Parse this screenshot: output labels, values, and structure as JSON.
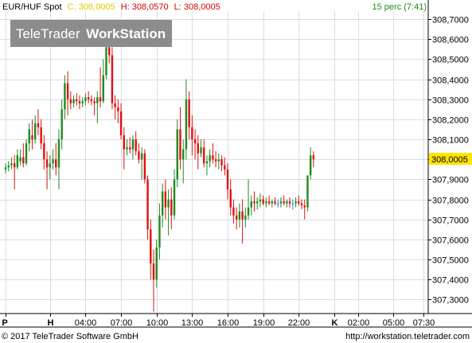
{
  "header": {
    "instrument": "EUR/HUF Spot",
    "close_label": "C: 308,0005",
    "high_label": "H: 308,0570",
    "low_label": "L: 308,0005",
    "interval": "15 perc (7:41)"
  },
  "watermark": {
    "brand": "TeleTrader",
    "product": "WorkStation"
  },
  "footer": {
    "copyright": "© 2017 TeleTrader Software GmbH",
    "url": "http://workstation.teletrader.com"
  },
  "colors": {
    "up": "#1f8a1f",
    "down": "#e01010",
    "doji": "#1a7fd0",
    "grid": "#dcdcdc",
    "last_price_bg": "#ffe400",
    "close_color": "#e8c800",
    "high_low_color": "#d40000",
    "interval_color": "#1a8a1a"
  },
  "chart_data": {
    "type": "candlestick",
    "ylim": [
      307.23,
      308.74
    ],
    "y_ticks": [
      "308,7000",
      "308,6000",
      "308,5000",
      "308,4000",
      "308,3000",
      "308,2000",
      "308,1000",
      "308,0000",
      "307,9000",
      "307,8000",
      "307,7000",
      "307,6000",
      "307,5000",
      "307,4000",
      "307,3000"
    ],
    "y_tick_values": [
      308.7,
      308.6,
      308.5,
      308.4,
      308.3,
      308.2,
      308.1,
      308.0,
      307.9,
      307.8,
      307.7,
      307.6,
      307.5,
      307.4,
      307.3
    ],
    "last_price": 308.0005,
    "last_price_label": "308,0005",
    "x_ticks": [
      {
        "label": "P",
        "bold": true,
        "index": 0
      },
      {
        "label": "H",
        "bold": true,
        "index": 15
      },
      {
        "label": "04:00",
        "index": 27
      },
      {
        "label": "07:00",
        "index": 39
      },
      {
        "label": "10:00",
        "index": 51
      },
      {
        "label": "13:00",
        "index": 63
      },
      {
        "label": "16:00",
        "index": 75
      },
      {
        "label": "19:00",
        "index": 87
      },
      {
        "label": "22:00",
        "index": 99
      },
      {
        "label": "K",
        "bold": true,
        "index": 111
      },
      {
        "label": "02:00",
        "index": 119
      },
      {
        "label": "05:00",
        "index": 131
      },
      {
        "label": "07:30",
        "index": 141
      }
    ],
    "ohlc": [
      [
        307.95,
        307.98,
        307.93,
        307.96
      ],
      [
        307.96,
        307.99,
        307.94,
        307.97
      ],
      [
        307.97,
        308.01,
        307.95,
        307.98
      ],
      [
        307.98,
        308.02,
        307.85,
        307.96
      ],
      [
        307.96,
        308.05,
        307.95,
        308.02
      ],
      [
        307.99,
        308.05,
        307.97,
        308.01
      ],
      [
        308.01,
        308.08,
        307.96,
        307.98
      ],
      [
        307.98,
        308.1,
        307.97,
        308.08
      ],
      [
        308.08,
        308.18,
        308.04,
        308.15
      ],
      [
        308.12,
        308.2,
        308.05,
        308.1
      ],
      [
        308.1,
        308.22,
        308.08,
        308.18
      ],
      [
        308.18,
        308.25,
        308.12,
        308.16
      ],
      [
        308.16,
        308.2,
        308.05,
        308.08
      ],
      [
        308.08,
        308.12,
        307.95,
        308.0
      ],
      [
        308.0,
        308.04,
        307.85,
        307.96
      ],
      [
        307.96,
        308.02,
        307.9,
        307.98
      ],
      [
        307.98,
        308.05,
        307.95,
        308.0
      ],
      [
        308.0,
        308.08,
        307.92,
        307.96
      ],
      [
        307.96,
        308.15,
        307.85,
        308.1
      ],
      [
        308.1,
        308.3,
        308.05,
        308.25
      ],
      [
        308.25,
        308.42,
        308.2,
        308.38
      ],
      [
        308.38,
        308.44,
        308.22,
        308.3
      ],
      [
        308.3,
        308.34,
        308.25,
        308.28
      ],
      [
        308.28,
        308.32,
        308.26,
        308.3
      ],
      [
        308.3,
        308.33,
        308.27,
        308.29
      ],
      [
        308.29,
        308.32,
        308.25,
        308.28
      ],
      [
        308.28,
        308.31,
        308.26,
        308.29
      ],
      [
        308.29,
        308.33,
        308.27,
        308.31
      ],
      [
        308.31,
        308.34,
        308.28,
        308.3
      ],
      [
        308.3,
        308.32,
        308.27,
        308.29
      ],
      [
        308.29,
        308.31,
        308.22,
        308.28
      ],
      [
        308.28,
        308.34,
        308.18,
        308.31
      ],
      [
        308.31,
        308.46,
        308.26,
        308.29
      ],
      [
        308.29,
        308.5,
        308.28,
        308.42
      ],
      [
        308.42,
        308.6,
        308.4,
        308.56
      ],
      [
        308.56,
        308.59,
        308.48,
        308.52
      ],
      [
        308.52,
        308.56,
        308.25,
        308.28
      ],
      [
        308.28,
        308.32,
        308.2,
        308.26
      ],
      [
        308.26,
        308.3,
        308.18,
        308.24
      ],
      [
        308.24,
        308.28,
        308.1,
        308.12
      ],
      [
        308.12,
        308.16,
        307.95,
        308.05
      ],
      [
        308.05,
        308.1,
        308.02,
        308.06
      ],
      [
        308.06,
        308.11,
        308.03,
        308.05
      ],
      [
        308.05,
        308.12,
        308.0,
        308.1
      ],
      [
        308.1,
        308.14,
        308.02,
        308.04
      ],
      [
        308.04,
        308.08,
        307.98,
        308.0
      ],
      [
        308.0,
        308.06,
        307.9,
        308.03
      ],
      [
        308.03,
        308.05,
        307.88,
        307.9
      ],
      [
        307.9,
        307.92,
        307.6,
        307.65
      ],
      [
        307.65,
        307.7,
        307.4,
        307.48
      ],
      [
        307.48,
        307.55,
        307.24,
        307.4
      ],
      [
        307.4,
        307.6,
        307.36,
        307.56
      ],
      [
        307.56,
        307.78,
        307.5,
        307.72
      ],
      [
        307.72,
        307.88,
        307.66,
        307.84
      ],
      [
        307.84,
        307.9,
        307.7,
        307.76
      ],
      [
        307.76,
        307.85,
        307.62,
        307.8
      ],
      [
        307.8,
        307.86,
        307.65,
        307.72
      ],
      [
        307.72,
        307.95,
        307.7,
        307.9
      ],
      [
        307.9,
        308.2,
        307.86,
        308.15
      ],
      [
        308.15,
        308.26,
        307.95,
        308.0
      ],
      [
        308.0,
        308.1,
        307.88,
        308.05
      ],
      [
        308.05,
        308.4,
        308.0,
        308.3
      ],
      [
        308.3,
        308.34,
        308.1,
        308.16
      ],
      [
        308.16,
        308.22,
        308.02,
        308.1
      ],
      [
        308.1,
        308.15,
        308.0,
        308.08
      ],
      [
        308.08,
        308.12,
        307.95,
        308.03
      ],
      [
        308.03,
        308.1,
        308.01,
        308.06
      ],
      [
        308.06,
        308.1,
        307.96,
        307.98
      ],
      [
        307.98,
        308.02,
        307.92,
        307.99
      ],
      [
        307.99,
        308.05,
        307.96,
        308.02
      ],
      [
        308.02,
        308.08,
        307.98,
        308.0
      ],
      [
        308.0,
        308.04,
        307.96,
        307.99
      ],
      [
        307.99,
        308.03,
        307.95,
        308.0
      ],
      [
        308.0,
        308.02,
        307.94,
        307.97
      ],
      [
        307.97,
        308.01,
        307.92,
        307.95
      ],
      [
        307.95,
        307.98,
        307.8,
        307.85
      ],
      [
        307.85,
        307.9,
        307.72,
        307.76
      ],
      [
        307.76,
        307.8,
        307.68,
        307.72
      ],
      [
        307.72,
        307.76,
        307.65,
        307.7
      ],
      [
        307.7,
        307.78,
        307.66,
        307.74
      ],
      [
        307.74,
        307.8,
        307.58,
        307.7
      ],
      [
        307.7,
        307.76,
        307.66,
        307.72
      ],
      [
        307.72,
        307.9,
        307.7,
        307.76
      ],
      [
        307.76,
        307.82,
        307.72,
        307.79
      ],
      [
        307.79,
        307.84,
        307.74,
        307.78
      ],
      [
        307.78,
        307.81,
        307.75,
        307.79
      ],
      [
        307.79,
        307.83,
        307.76,
        307.8
      ],
      [
        307.8,
        307.82,
        307.77,
        307.78
      ],
      [
        307.78,
        307.81,
        307.76,
        307.79
      ],
      [
        307.79,
        307.82,
        307.77,
        307.78
      ],
      [
        307.78,
        307.8,
        307.76,
        307.79
      ],
      [
        307.79,
        307.81,
        307.77,
        307.78
      ],
      [
        307.78,
        307.8,
        307.76,
        307.78
      ],
      [
        307.78,
        307.81,
        307.76,
        307.79
      ],
      [
        307.79,
        307.82,
        307.77,
        307.78
      ],
      [
        307.78,
        307.8,
        307.76,
        307.79
      ],
      [
        307.79,
        307.81,
        307.76,
        307.78
      ],
      [
        307.78,
        307.8,
        307.75,
        307.78
      ],
      [
        307.78,
        307.81,
        307.76,
        307.79
      ],
      [
        307.79,
        307.82,
        307.77,
        307.78
      ],
      [
        307.78,
        307.8,
        307.75,
        307.77
      ],
      [
        307.77,
        307.8,
        307.7,
        307.76
      ],
      [
        307.76,
        307.9,
        307.74,
        307.92
      ],
      [
        307.92,
        308.06,
        307.9,
        308.02
      ],
      [
        308.02,
        308.04,
        307.96,
        308.0
      ]
    ]
  }
}
